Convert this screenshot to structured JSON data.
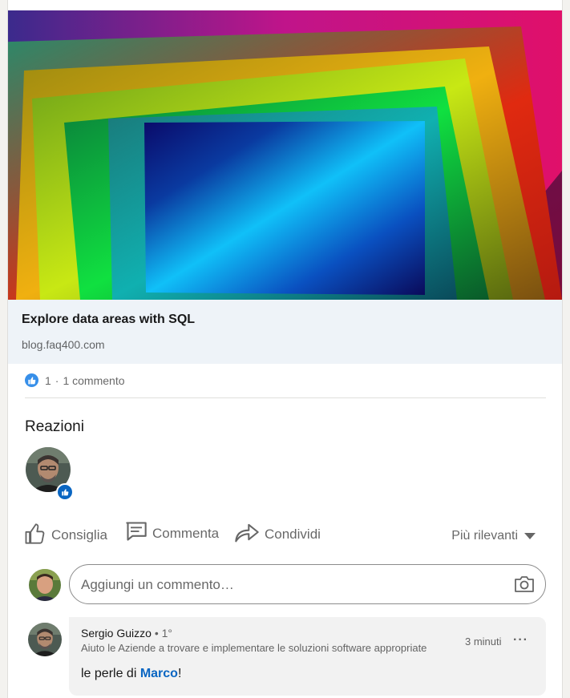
{
  "article": {
    "title": "Explore data areas with SQL",
    "domain": "blog.faq400.com"
  },
  "social": {
    "reaction_count": "1",
    "separator": "·",
    "comments_count": "1 commento"
  },
  "reactions": {
    "title": "Reazioni"
  },
  "actions": {
    "like": "Consiglia",
    "comment": "Commenta",
    "share": "Condividi",
    "sort": "Più rilevanti"
  },
  "composer": {
    "placeholder": "Aggiungi un commento…"
  },
  "comment": {
    "author": "Sergio Guizzo",
    "degree": "• 1°",
    "headline": "Aiuto le Aziende a trovare e implementare le soluzioni software appropriate",
    "time": "3 minuti",
    "more": "···",
    "text_before": "le perle di ",
    "mention": "Marco",
    "text_after": "!"
  },
  "icons": {
    "like_badge": "thumbs-up-icon",
    "like_action": "thumbs-up-outline-icon",
    "comment_action": "comment-icon",
    "share_action": "share-arrow-icon",
    "camera": "camera-icon",
    "sort_caret": "caret-down-icon"
  },
  "colors": {
    "accent": "#0a66c2",
    "like_badge": "#378fe9",
    "article_meta_bg": "#eef3f8",
    "comment_bubble_bg": "#f2f2f2"
  }
}
